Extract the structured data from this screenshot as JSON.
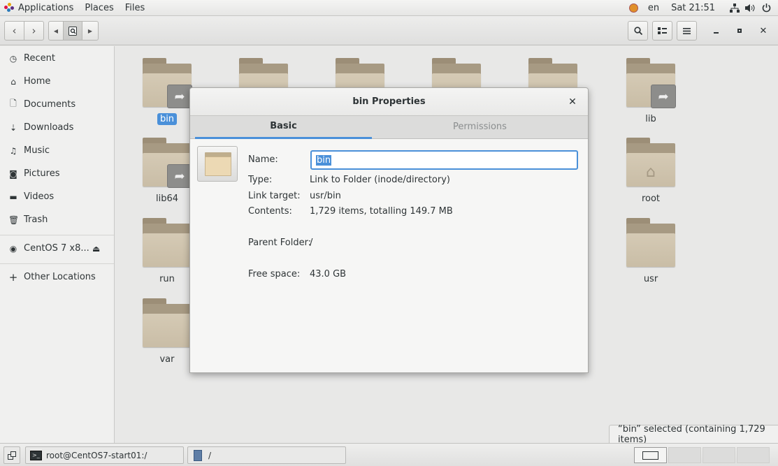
{
  "topbar": {
    "menus": [
      "Applications",
      "Places",
      "Files"
    ],
    "lang": "en",
    "clock": "Sat 21:51"
  },
  "sidebar": {
    "items": [
      {
        "label": "Recent",
        "icon": "clock-icon"
      },
      {
        "label": "Home",
        "icon": "home-icon"
      },
      {
        "label": "Documents",
        "icon": "document-icon"
      },
      {
        "label": "Downloads",
        "icon": "download-icon"
      },
      {
        "label": "Music",
        "icon": "music-icon"
      },
      {
        "label": "Pictures",
        "icon": "camera-icon"
      },
      {
        "label": "Videos",
        "icon": "video-icon"
      },
      {
        "label": "Trash",
        "icon": "trash-icon"
      }
    ],
    "device": "CentOS 7 x8...",
    "other": "Other Locations"
  },
  "folders": [
    {
      "name": "bin",
      "link": true,
      "selected": true
    },
    {
      "name": "lib",
      "link": true
    },
    {
      "name": "lib64",
      "link": true
    },
    {
      "name": "root",
      "home": true
    },
    {
      "name": "run"
    },
    {
      "name": "usr"
    },
    {
      "name": "var"
    }
  ],
  "status": "“bin” selected  (containing 1,729 items)",
  "dialog": {
    "title": "bin Properties",
    "tabs": [
      "Basic",
      "Permissions"
    ],
    "name_label": "Name:",
    "name_value": "bin",
    "rows": [
      {
        "label": "Type:",
        "value": "Link to Folder (inode/directory)"
      },
      {
        "label": "Link target:",
        "value": "usr/bin"
      },
      {
        "label": "Contents:",
        "value": "1,729 items, totalling 149.7 MB"
      },
      {
        "label": "Parent Folder:",
        "value": "/"
      },
      {
        "label": "Free space:",
        "value": "43.0 GB"
      }
    ]
  },
  "taskbar": {
    "terminal": "root@CentOS7-start01:/",
    "files": "/"
  }
}
